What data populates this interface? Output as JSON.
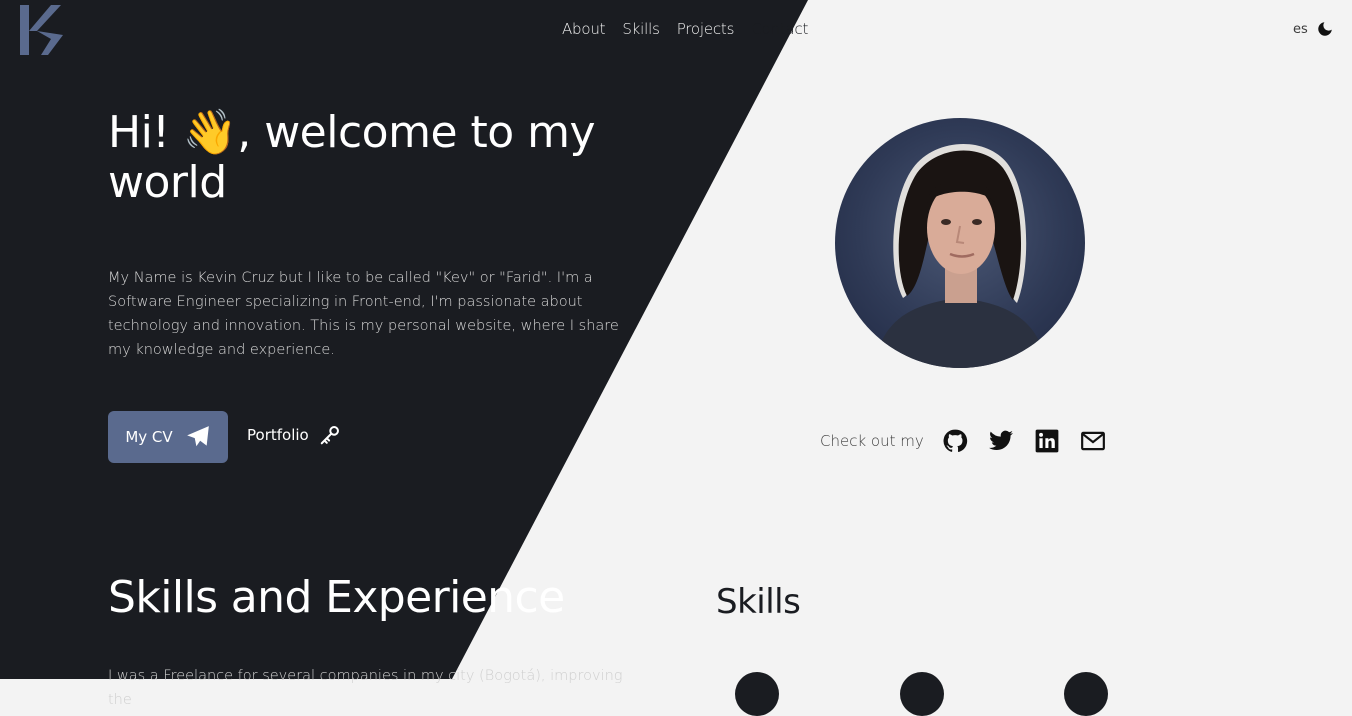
{
  "nav": {
    "items": [
      {
        "label": "About"
      },
      {
        "label": "Skills"
      },
      {
        "label": "Projects"
      },
      {
        "label": "Contact"
      }
    ],
    "lang": "es"
  },
  "hero": {
    "title": "Hi! 👋, welcome to my world",
    "intro": "My Name is Kevin Cruz but I like to be called \"Kev\" or \"Farid\". I'm a Software Engineer specializing in Front-end, I'm passionate about technology and innovation. This is my personal website, where I share my knowledge and experience.",
    "cv_label": "My CV",
    "portfolio_label": "Portfolio"
  },
  "social": {
    "label": "Check out my",
    "icons": [
      "github-icon",
      "twitter-icon",
      "linkedin-icon",
      "mail-icon"
    ]
  },
  "skills": {
    "title": "Skills and Experience",
    "intro": "I was a Freelance for several companies in my city (Bogotá), improving the",
    "subtitle": "Skills"
  },
  "colors": {
    "dark": "#1a1c21",
    "light": "#f3f3f3",
    "accent": "#5a6a8e"
  }
}
